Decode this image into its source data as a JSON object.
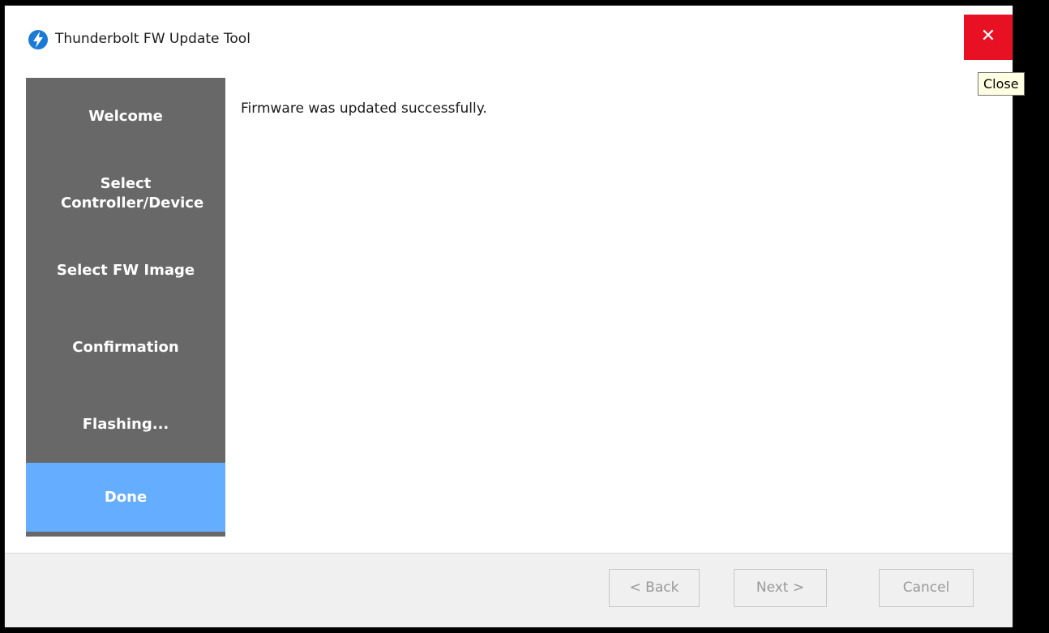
{
  "window": {
    "title": "Thunderbolt FW Update Tool",
    "close_glyph": "✕",
    "close_tooltip": "Close"
  },
  "icons": {
    "app": "thunderbolt-icon",
    "close": "close-icon"
  },
  "sidebar": {
    "items": [
      {
        "label": "Welcome",
        "active": false
      },
      {
        "label": "Select Controller/Device",
        "active": false
      },
      {
        "label": "Select FW Image",
        "active": false
      },
      {
        "label": "Confirmation",
        "active": false
      },
      {
        "label": "Flashing...",
        "active": false
      },
      {
        "label": "Done",
        "active": true
      }
    ]
  },
  "content": {
    "message": "Firmware was updated successfully."
  },
  "buttons": {
    "back": "< Back",
    "next": "Next >",
    "cancel": "Cancel"
  },
  "colors": {
    "close_bg": "#e81123",
    "sidebar_bg": "#686868",
    "active_step": "#65adff"
  }
}
